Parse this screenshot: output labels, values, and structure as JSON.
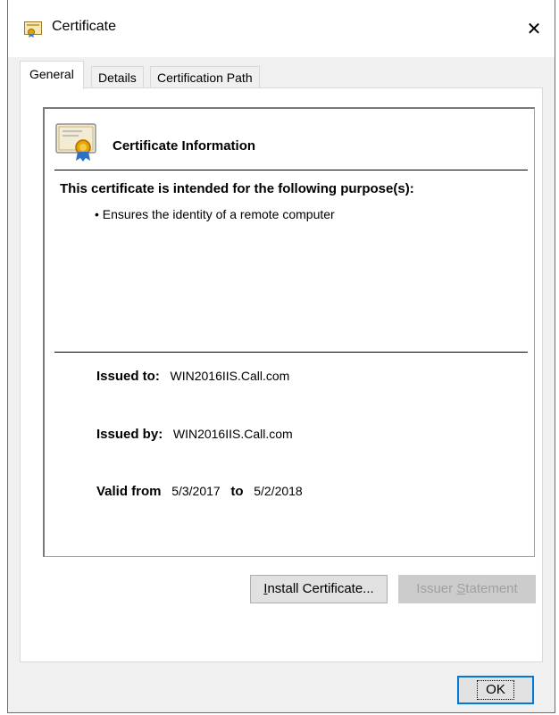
{
  "window": {
    "title": "Certificate",
    "close_glyph": "✕"
  },
  "tabs": [
    {
      "label": "General",
      "active": true
    },
    {
      "label": "Details",
      "active": false
    },
    {
      "label": "Certification Path",
      "active": false
    }
  ],
  "info": {
    "title": "Certificate Information",
    "purpose_heading": "This certificate is intended for the following purpose(s):",
    "purposes": [
      "• Ensures the identity of a remote computer"
    ],
    "issued_to_label": "Issued to:",
    "issued_to": "WIN2016IIS.Call.com",
    "issued_by_label": "Issued by:",
    "issued_by": "WIN2016IIS.Call.com",
    "valid_from_label": "Valid from",
    "valid_from": "5/3/2017",
    "to_label": "to",
    "valid_to": "5/2/2018"
  },
  "buttons": {
    "install_prefix": "I",
    "install_rest": "nstall Certificate...",
    "issuer_prefix": "Issuer ",
    "issuer_accel": "S",
    "issuer_rest": "tatement",
    "ok": "OK"
  },
  "colors": {
    "accent": "#0078d7",
    "window_bg": "#f0f0f0",
    "disabled_text": "#a0a0a0"
  }
}
